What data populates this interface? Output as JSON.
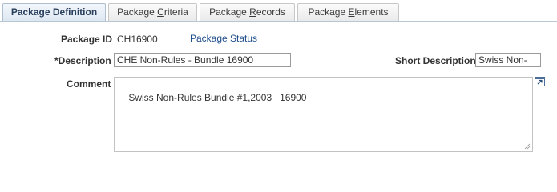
{
  "tabs": [
    {
      "label": "Package Definition",
      "active": true
    },
    {
      "label_pre": "Package ",
      "label_u": "C",
      "label_post": "riteria",
      "active": false
    },
    {
      "label_pre": "Package ",
      "label_u": "R",
      "label_post": "ecords",
      "active": false
    },
    {
      "label_pre": "Package ",
      "label_u": "E",
      "label_post": "lements",
      "active": false
    }
  ],
  "form": {
    "package_id_label": "Package ID",
    "package_id_value": "CH16900",
    "package_status_link": "Package Status",
    "description_label": "*Description",
    "description_value": "CHE Non-Rules - Bundle 16900",
    "short_description_label": "Short Description",
    "short_description_value": "Swiss Non-",
    "comment_label": "Comment",
    "comment_value": "Swiss Non-Rules Bundle #1,2003   16900"
  },
  "icons": {
    "expand": "expand-textarea-icon",
    "resize": "resize-grip-icon"
  },
  "colors": {
    "link": "#1f4e8c",
    "active_tab": "#dce6f1",
    "label": "#333333"
  }
}
